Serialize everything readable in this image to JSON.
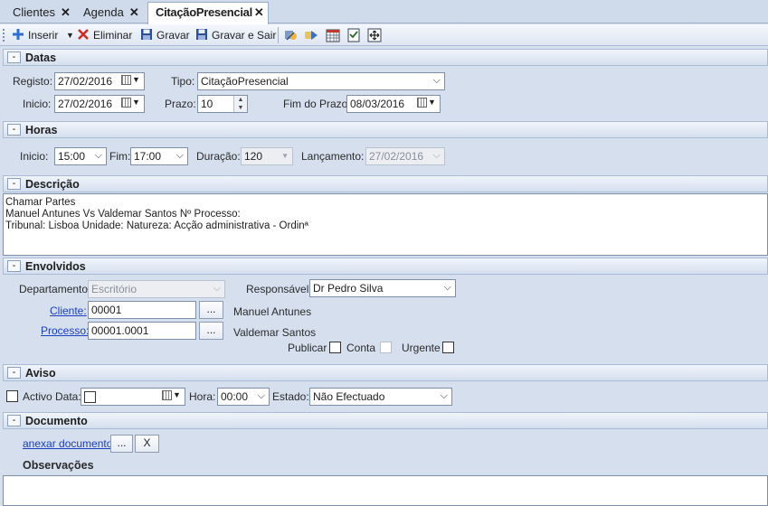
{
  "tabs": [
    {
      "label": "Clientes",
      "close": "✕"
    },
    {
      "label": "Agenda",
      "close": "✕"
    },
    {
      "label": "CitaçãoPresencial",
      "close": "✕"
    }
  ],
  "toolbar": {
    "insert": "Inserir",
    "delete": "Eliminar",
    "save": "Gravar",
    "save_exit": "Gravar e Sair"
  },
  "datas": {
    "title": "Datas",
    "toggle": "-",
    "registo_label": "Registo:",
    "registo_value": "27/02/2016",
    "tipo_label": "Tipo:",
    "tipo_value": "CitaçãoPresencial",
    "inicio_label": "Inicio:",
    "inicio_value": "27/02/2016",
    "prazo_label": "Prazo:",
    "prazo_value": "10",
    "fim_label": "Fim do Prazo:",
    "fim_value": "08/03/2016"
  },
  "horas": {
    "title": "Horas",
    "toggle": "-",
    "inicio_label": "Inicio:",
    "inicio_value": "15:00",
    "fim_label": "Fim:",
    "fim_value": "17:00",
    "duracao_label": "Duração:",
    "duracao_value": "120",
    "lancamento_label": "Lançamento:",
    "lancamento_value": "27/02/2016"
  },
  "descricao": {
    "title": "Descrição",
    "toggle": "-",
    "lines": [
      "Chamar Partes",
      "Manuel Antunes Vs Valdemar Santos Nº Processo:",
      "Tribunal: Lisboa Unidade:  Natureza: Acção administrativa - Ordinª"
    ]
  },
  "envolvidos": {
    "title": "Envolvidos",
    "toggle": "-",
    "departamento_label": "Departamento:",
    "departamento_value": "Escritório",
    "responsavel_label": "Responsável:",
    "responsavel_value": "Dr Pedro Silva",
    "cliente_label": "Cliente:",
    "cliente_value": "00001",
    "cliente_name": "Manuel Antunes",
    "processo_label": "Processo:",
    "processo_value": "00001.0001",
    "processo_name": "Valdemar Santos",
    "browse": "...",
    "publicar_label": "Publicar",
    "conta_label": "Conta",
    "urgente_label": "Urgente"
  },
  "aviso": {
    "title": "Aviso",
    "toggle": "-",
    "activo_label": "Activo",
    "data_label": "Data:",
    "hora_label": "Hora:",
    "hora_value": "00:00",
    "estado_label": "Estado:",
    "estado_value": "Não Efectuado"
  },
  "documento": {
    "title": "Documento",
    "toggle": "-",
    "attach_link": "anexar documento",
    "browse": "...",
    "remove": "X"
  },
  "observacoes": {
    "title": "Observações"
  },
  "icons": {
    "dropdown": "⌵",
    "spin_up": "▲",
    "spin_down": "▼"
  }
}
